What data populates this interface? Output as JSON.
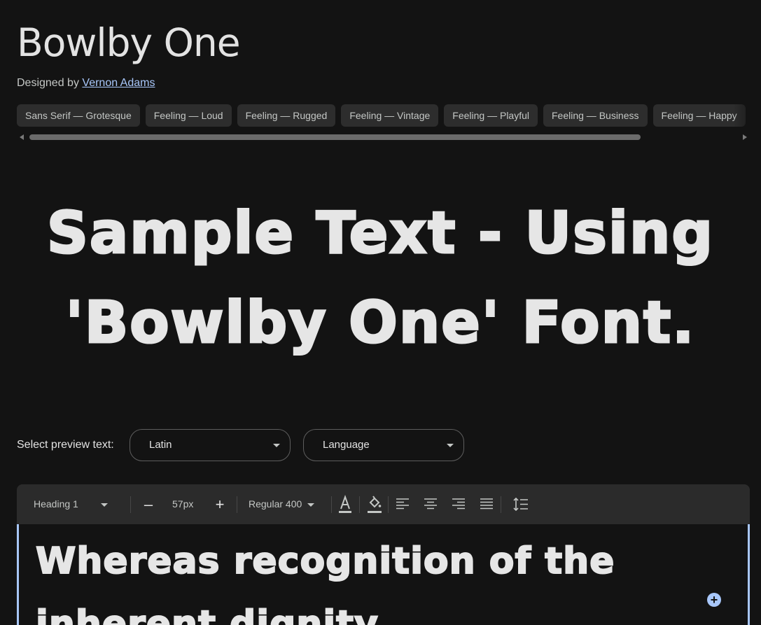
{
  "font": {
    "name": "Bowlby One",
    "designer_prefix": "Designed by",
    "designer": "Vernon Adams"
  },
  "tags": [
    "Sans Serif — Grotesque",
    "Feeling — Loud",
    "Feeling — Rugged",
    "Feeling — Vintage",
    "Feeling — Playful",
    "Feeling — Business",
    "Feeling — Happy"
  ],
  "sample_text": "Sample Text - Using 'Bowlby One' Font.",
  "preview": {
    "label": "Select preview text:",
    "script_value": "Latin",
    "language_value": "Language"
  },
  "toolbar": {
    "style": "Heading 1",
    "decrease": "–",
    "size": "57px",
    "increase": "+",
    "weight": "Regular 400"
  },
  "editor": {
    "text": "Whereas recognition of the inherent dignity"
  },
  "colors": {
    "background": "#131313",
    "link": "#a8c7fa",
    "chip": "#2d2d2d",
    "accent": "#a8c7fa"
  }
}
